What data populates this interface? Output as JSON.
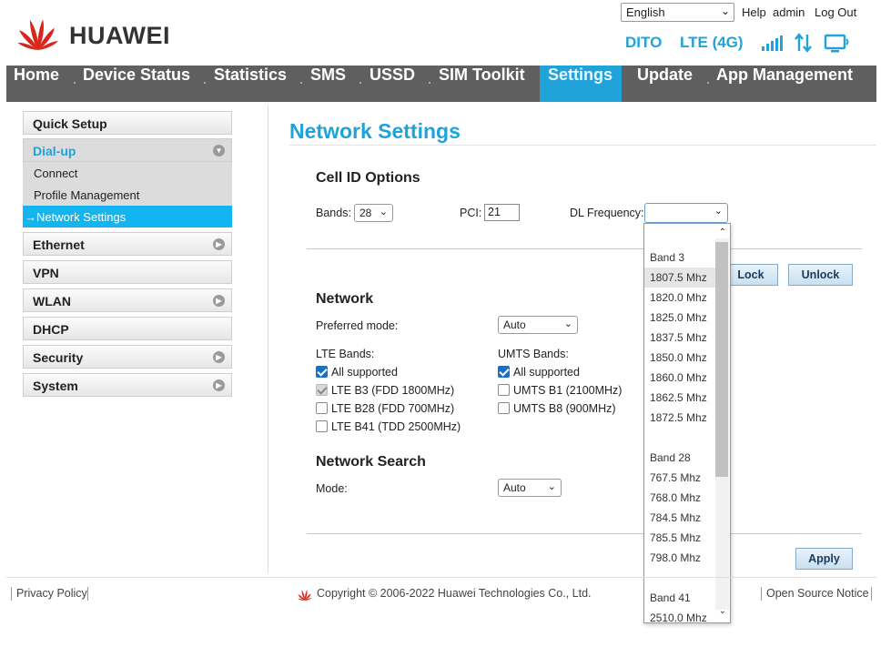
{
  "header": {
    "brand": "HUAWEI",
    "language": "English",
    "help": "Help",
    "user": "admin",
    "logout": "Log Out",
    "carrier": "DITO",
    "network_type": "LTE (4G)",
    "icons": [
      "huawei-logo",
      "signal-icon",
      "data-updown-icon",
      "monitor-icon"
    ]
  },
  "nav": [
    "Home",
    "Device Status",
    "Statistics",
    "SMS",
    "USSD",
    "SIM Toolkit",
    "Settings",
    "Update",
    "App Management"
  ],
  "sidebar": {
    "quick_setup": "Quick Setup",
    "dialup": "Dial-up",
    "dialup_items": [
      "Connect",
      "Profile Management",
      "→Network Settings"
    ],
    "sections": [
      "Ethernet",
      "VPN",
      "WLAN",
      "DHCP",
      "Security",
      "System"
    ]
  },
  "main": {
    "title": "Network Settings",
    "cell_id": {
      "heading": "Cell ID Options",
      "bands_label": "Bands:",
      "bands_value": "28",
      "pci_label": "PCI:",
      "pci_value": "21",
      "dl_label": "DL Frequency:",
      "dl_value": ""
    },
    "lock_label": "Lock",
    "unlock_label": "Unlock",
    "network": {
      "heading": "Network",
      "preferred_label": "Preferred mode:",
      "preferred_value": "Auto",
      "lte_label": "LTE Bands:",
      "umts_label": "UMTS Bands:",
      "lte_all": "All supported",
      "lte_b3": "LTE B3 (FDD 1800MHz)",
      "lte_b28": "LTE B28 (FDD 700MHz)",
      "lte_b41": "LTE B41 (TDD 2500MHz)",
      "umts_all": "All supported",
      "umts_b1": "UMTS B1 (2100MHz)",
      "umts_b8": "UMTS B8 (900MHz)"
    },
    "search": {
      "heading": "Network Search",
      "mode_label": "Mode:",
      "mode_value": "Auto"
    },
    "apply_label": "Apply"
  },
  "dropdown": {
    "items": [
      "Band 3",
      "1807.5 Mhz",
      "1820.0 Mhz",
      "1825.0 Mhz",
      "1837.5 Mhz",
      "1850.0 Mhz",
      "1860.0 Mhz",
      "1862.5 Mhz",
      "1872.5 Mhz",
      "",
      "Band 28",
      "767.5 Mhz",
      "768.0 Mhz",
      "784.5 Mhz",
      "785.5 Mhz",
      "798.0 Mhz",
      "",
      "",
      "Band 41",
      "2510.0 Mhz"
    ],
    "highlighted": "1807.5 Mhz"
  },
  "footer": {
    "privacy": "Privacy Policy",
    "copyright": "Copyright © 2006-2022 Huawei Technologies Co., Ltd.",
    "open_source": "Open Source Notice"
  },
  "colors": {
    "accent": "#1fa3d9",
    "nav_bg": "#5f5f5f",
    "side_active": "#12b5ef",
    "brand_red": "#d9261c"
  }
}
